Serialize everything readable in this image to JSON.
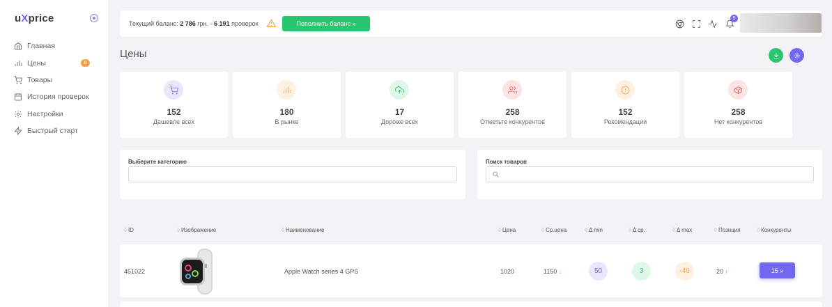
{
  "sidebar": {
    "logo_pre": "u",
    "logo_x": "X",
    "logo_post": "price",
    "items": [
      {
        "label": "Главная",
        "icon": "home-icon"
      },
      {
        "label": "Цены",
        "icon": "bar-chart-icon",
        "badge": "9"
      },
      {
        "label": "Товары",
        "icon": "cart-icon"
      },
      {
        "label": "История проверок",
        "icon": "calendar-icon"
      },
      {
        "label": "Настройки",
        "icon": "gear-icon"
      },
      {
        "label": "Быстрый старт",
        "icon": "bolt-icon"
      }
    ]
  },
  "topbar": {
    "balance_prefix": "Текущий баланс:",
    "balance_amount": "2 786",
    "balance_currency": "грн.",
    "balance_sep": "-",
    "checks_count": "6 191",
    "checks_label": "проверок",
    "topup_label": "Пополнить баланс »",
    "bell_count": "5"
  },
  "page": {
    "title": "Цены"
  },
  "stats": [
    {
      "value": "152",
      "label": "Дешевле всех",
      "icon": "cart-icon",
      "color": "#7367f0",
      "bg": "#e9e7fd"
    },
    {
      "value": "180",
      "label": "В рынке",
      "icon": "bar-chart-icon",
      "color": "#ff9f43",
      "bg": "#fff0e1"
    },
    {
      "value": "17",
      "label": "Дороже всех",
      "icon": "upload-cloud-icon",
      "color": "#28c76f",
      "bg": "#dff7e9"
    },
    {
      "value": "258",
      "label": "Отметьте конкурентов",
      "icon": "users-icon",
      "color": "#ea5455",
      "bg": "#fce4e4"
    },
    {
      "value": "152",
      "label": "Рекомендации",
      "icon": "alert-circle-icon",
      "color": "#ff9f43",
      "bg": "#fff0e1"
    },
    {
      "value": "258",
      "label": "Нет конкурентов",
      "icon": "box-icon",
      "color": "#ea5455",
      "bg": "#fce4e4"
    }
  ],
  "filters": {
    "category_label": "Выберите категорию",
    "category_value": "",
    "search_label": "Поиск товаров",
    "search_value": ""
  },
  "table": {
    "columns": [
      "ID",
      "Изображение",
      "Наименование",
      "Цена",
      "Ср.цена",
      "Δ min",
      "Δ ср.",
      "Δ max",
      "Позиция",
      "Конкуренты"
    ],
    "rows": [
      {
        "id": "451022",
        "name": "Apple Watch series 4 GPS",
        "price": "1020",
        "avg_price": "1150",
        "avg_arrow": "↓",
        "delta_min": "50",
        "delta_avg": "3",
        "delta_max": "-40",
        "position": "20",
        "position_arrow": "↑",
        "competitors_label": "15 »"
      }
    ]
  },
  "colors": {
    "primary": "#7367f0",
    "success": "#28c76f",
    "warning": "#ff9f43",
    "danger": "#ea5455"
  }
}
